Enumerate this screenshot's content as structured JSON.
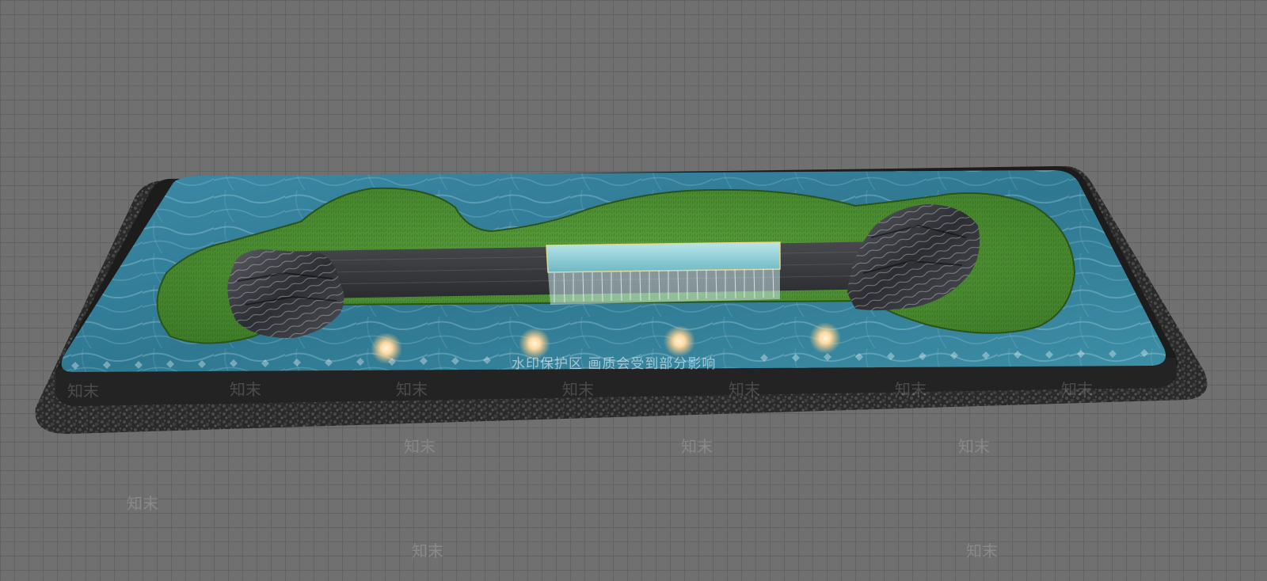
{
  "watermark": {
    "notice": "水印保护区   画质会受到部分影响",
    "brand": "知末"
  },
  "scene": {
    "subject": "water-feature-pond-model",
    "lights_count": 4,
    "colors": {
      "ground": "#6e6e6e",
      "grid_line": "#585858",
      "gravel": "#2c2c2c",
      "rim": "#1e1e1e",
      "water": "#3f8ca3",
      "grass": "#4f8f33",
      "rock": "#3a3c40",
      "wall": "#2f3033",
      "light_glow": "#ffd9a0"
    }
  }
}
